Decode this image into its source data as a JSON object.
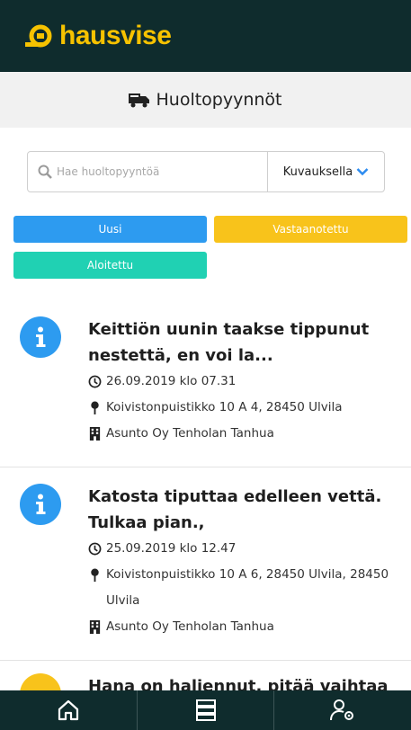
{
  "brand": {
    "name": "hausvise",
    "color": "#f6c200",
    "header_bg": "#0f2c2d"
  },
  "page": {
    "title": "Huoltopyynnöt",
    "title_icon": "truck-icon"
  },
  "search": {
    "placeholder": "Hae huoltopyyntöä",
    "value": "",
    "filter_label": "Kuvauksella"
  },
  "status_filters": [
    {
      "label": "Uusi",
      "color": "#2d9bf0"
    },
    {
      "label": "Vastaanotettu",
      "color": "#f8c31b"
    },
    {
      "label": "Aloitettu",
      "color": "#20d1b3"
    }
  ],
  "requests": [
    {
      "title": "Keittiön uunin taakse tippunut nestettä, en voi la...",
      "datetime": "26.09.2019 klo 07.31",
      "address": "Koivistonpuistikko 10 A 4, 28450 Ulvila",
      "company": "Asunto Oy Tenholan Tanhua",
      "status_icon": "info-icon",
      "status_color": "#2d9bf0"
    },
    {
      "title": "Katosta tiputtaa edelleen vettä. Tulkaa pian.,",
      "datetime": "25.09.2019 klo 12.47",
      "address": "Koivistonpuistikko 10 A 6, 28450 Ulvila, 28450 Ulvila",
      "company": "Asunto Oy Tenholan Tanhua",
      "status_icon": "info-icon",
      "status_color": "#2d9bf0"
    },
    {
      "title": "Hana on haljennut, pitää vaihtaa",
      "status_color": "#f8c31b"
    }
  ],
  "bottom_nav": [
    {
      "icon": "home-icon"
    },
    {
      "icon": "building-list-icon"
    },
    {
      "icon": "user-settings-icon"
    }
  ]
}
